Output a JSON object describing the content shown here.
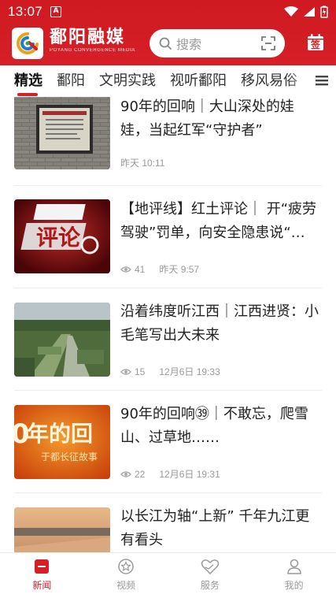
{
  "status_bar": {
    "time": "13:07",
    "notif_badge": "A"
  },
  "header": {
    "brand_cn": "鄱阳融媒",
    "brand_en": "POYANG CONVERGENCE MEDIA",
    "search_placeholder": "搜索",
    "sign_label": "签",
    "accent_color": "#d61f26"
  },
  "tabs": [
    {
      "label": "精选",
      "active": true
    },
    {
      "label": "鄱阳"
    },
    {
      "label": "文明实践"
    },
    {
      "label": "视听鄱阳"
    },
    {
      "label": "移风易俗"
    }
  ],
  "news": [
    {
      "title": "90年的回响｜大山深处的娃娃，当起红军“守护者”",
      "views": "",
      "time": "昨天 10:11",
      "thumb": "plaque-photo"
    },
    {
      "title": "【地评线】红土评论｜ 开“疲劳驾驶”罚单，向安全隐患说“…",
      "views": "41",
      "time": "昨天 9:57",
      "thumb": "hongtu-pinglun-logo",
      "thumb_text": "评论"
    },
    {
      "title": "沿着纬度听江西｜江西进贤：小毛笔写出大未来",
      "views": "15",
      "time": "12月6日 19:33",
      "thumb": "aerial-park-photo"
    },
    {
      "title": "90年的回响㊴｜不敢忘，爬雪山、过草地……",
      "views": "22",
      "time": "12月6日 19:31",
      "thumb": "orange-title-card",
      "thumb_text": "年的回",
      "thumb_sub": "于都长征故事"
    },
    {
      "title": "以长江为轴“上新” 千年九江更有看头",
      "views": "",
      "time": "",
      "thumb": "river-city-photo"
    }
  ],
  "bottom_nav": [
    {
      "label": "新闻",
      "icon": "news-icon",
      "active": true
    },
    {
      "label": "视频",
      "icon": "video-star-icon"
    },
    {
      "label": "服务",
      "icon": "heart-service-icon"
    },
    {
      "label": "我的",
      "icon": "user-icon"
    }
  ]
}
